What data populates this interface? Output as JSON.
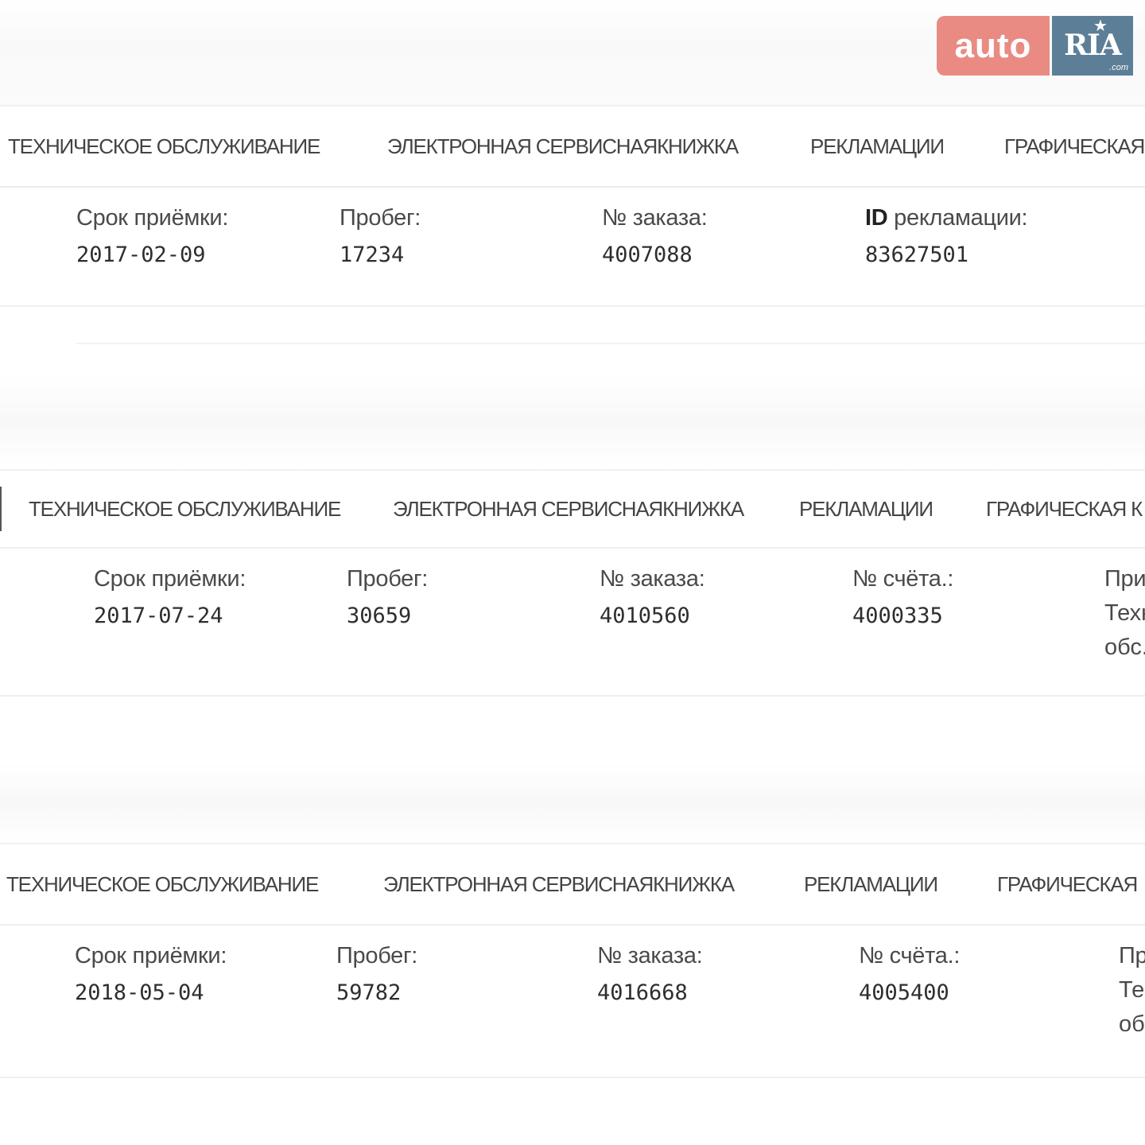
{
  "logo": {
    "auto": "auto",
    "ria": "RIA",
    "com": ".com"
  },
  "tabs": {
    "maintenance": "ТЕХНИЧЕСКОЕ ОБСЛУЖИВАНИЕ",
    "service_book": "ЭЛЕКТРОННАЯ СЕРВИСНАЯКНИЖКА",
    "claims": "РЕКЛАМАЦИИ",
    "graphic_1": "ГРАФИЧЕСКАЯ",
    "graphic_2": "ГРАФИЧЕСКАЯ К",
    "graphic_3": "ГРАФИЧЕСКАЯ"
  },
  "labels": {
    "date": "Срок приёмки:",
    "mileage": "Пробег:",
    "order": "№ заказа:",
    "invoice": "№ счёта.:",
    "claim_id_bold": "ID",
    "claim_id_rest": " рекламации:"
  },
  "records": [
    {
      "date": "2017-02-09",
      "mileage": "17234",
      "order": "4007088",
      "claim_id": "83627501"
    },
    {
      "date": "2017-07-24",
      "mileage": "30659",
      "order": "4010560",
      "invoice": "4000335",
      "cut_label": "При",
      "cut_line1": "Техн",
      "cut_line2": "обс."
    },
    {
      "date": "2018-05-04",
      "mileage": "59782",
      "order": "4016668",
      "invoice": "4005400",
      "cut_label": "Пр",
      "cut_line1": "Те",
      "cut_line2": "об"
    }
  ]
}
